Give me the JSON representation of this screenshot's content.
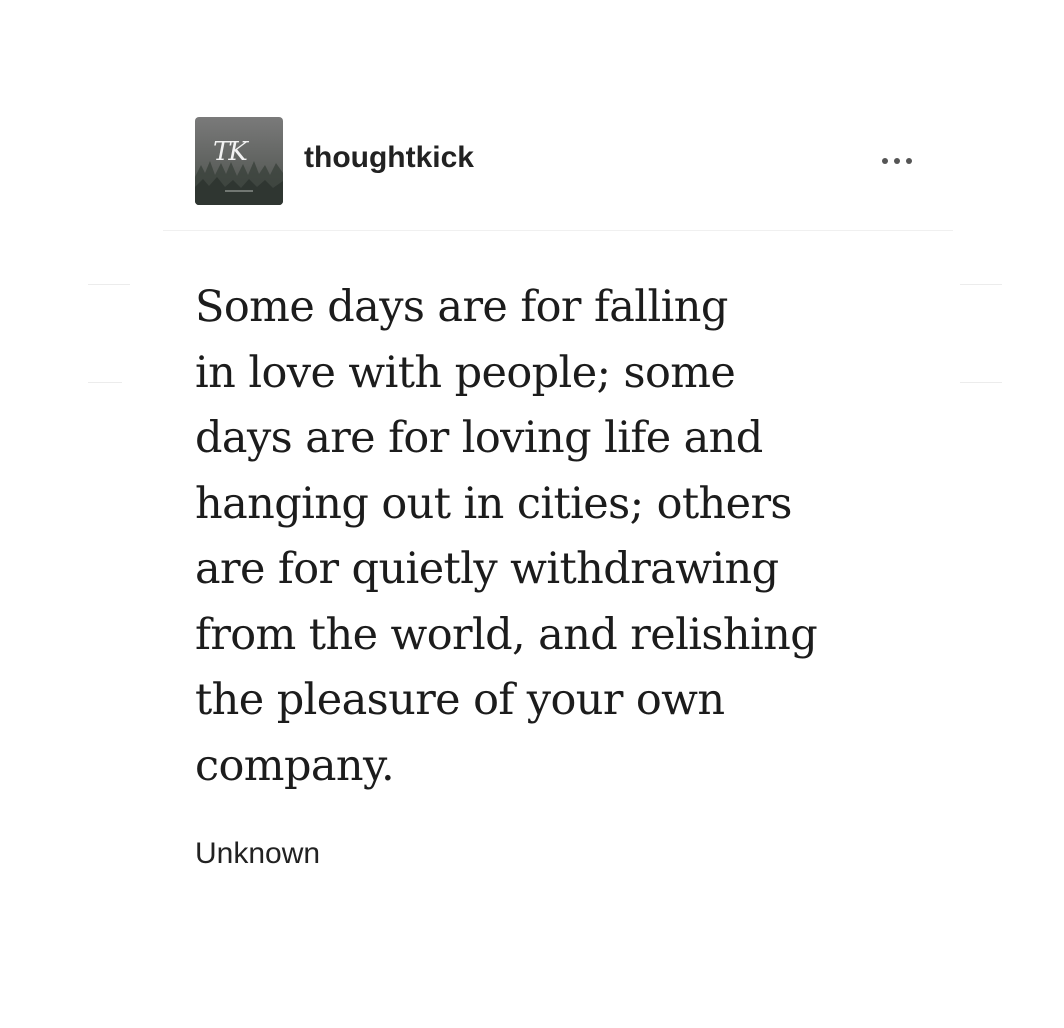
{
  "post": {
    "author": {
      "avatar_initials": "TK",
      "username": "thoughtkick"
    },
    "more_icon": "ellipsis-icon",
    "quote_lines": [
      "Some days are for falling",
      "in love with people; some",
      "days are for loving life and",
      "hanging out in cities; others",
      "are for quietly withdrawing",
      "from the world, and relishing",
      "the pleasure of your own",
      "company."
    ],
    "attribution": "Unknown"
  },
  "colors": {
    "background": "#ffffff",
    "text": "#1c1c1c",
    "divider": "#f0f0f0",
    "avatar": "#5f625f"
  }
}
